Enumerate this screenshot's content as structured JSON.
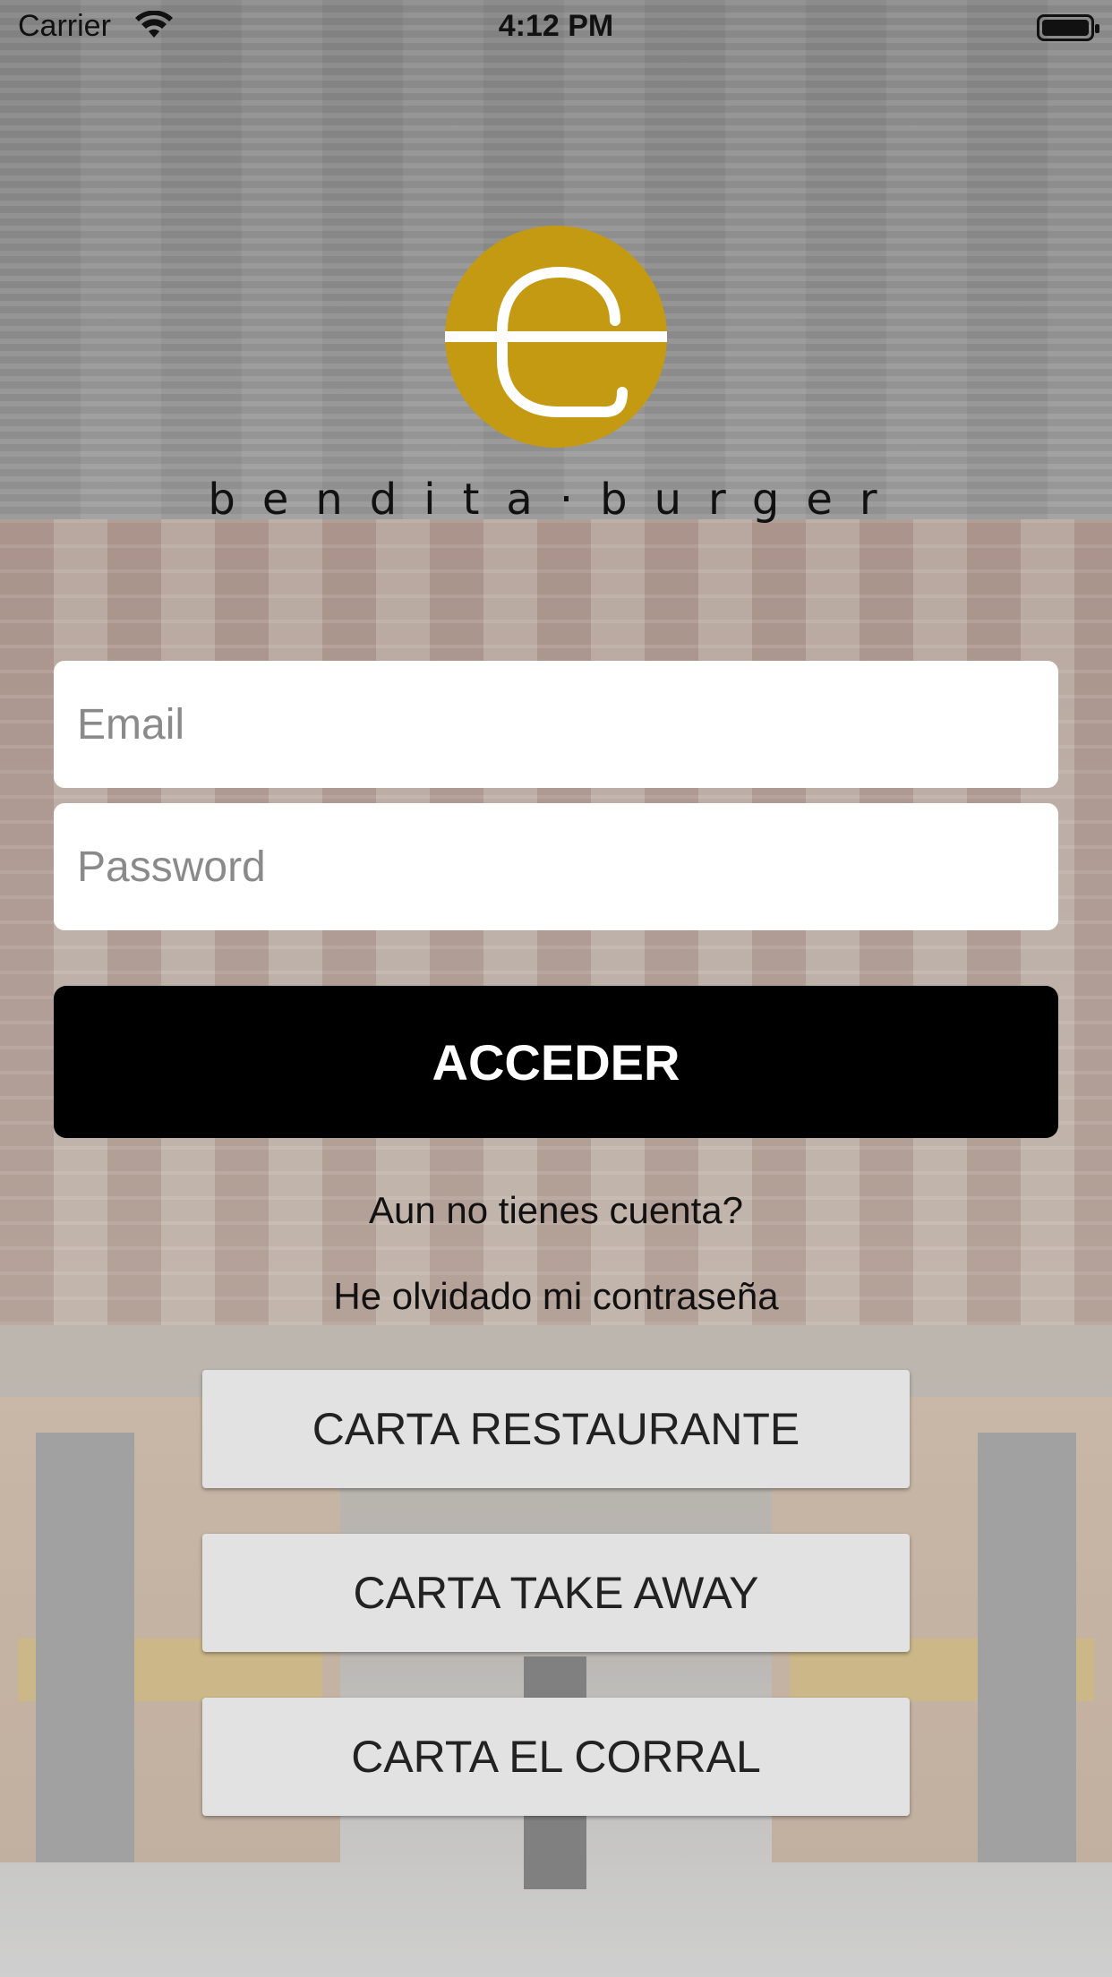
{
  "status_bar": {
    "carrier": "Carrier",
    "time": "4:12 PM"
  },
  "brand": {
    "name": "bendita·burger",
    "logo_color": "#c39a12"
  },
  "login": {
    "email_placeholder": "Email",
    "password_placeholder": "Password",
    "submit_label": "ACCEDER"
  },
  "links": {
    "signup": "Aun no tienes cuenta?",
    "forgot_password": "He olvidado mi contraseña"
  },
  "menus": [
    {
      "label": "CARTA RESTAURANTE"
    },
    {
      "label": "CARTA TAKE AWAY"
    },
    {
      "label": "CARTA EL CORRAL"
    }
  ]
}
